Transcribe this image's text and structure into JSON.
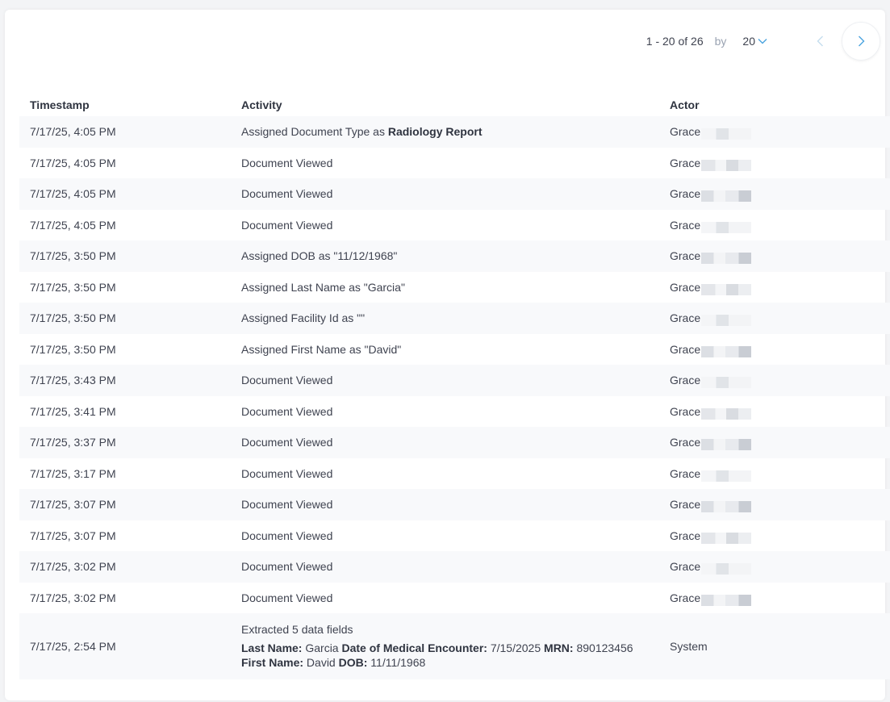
{
  "pagination": {
    "range": "1 - 20 of 26",
    "by_label": "by",
    "page_size": "20"
  },
  "table": {
    "headers": {
      "timestamp": "Timestamp",
      "activity": "Activity",
      "actor": "Actor"
    },
    "rows": [
      {
        "timestamp": "7/17/25, 4:05 PM",
        "activity_prefix": "Assigned Document Type as ",
        "activity_bold": "Radiology Report",
        "actor": "Grace"
      },
      {
        "timestamp": "7/17/25, 4:05 PM",
        "activity_prefix": "Document Viewed",
        "activity_bold": "",
        "actor": "Grace"
      },
      {
        "timestamp": "7/17/25, 4:05 PM",
        "activity_prefix": "Document Viewed",
        "activity_bold": "",
        "actor": "Grace"
      },
      {
        "timestamp": "7/17/25, 4:05 PM",
        "activity_prefix": "Document Viewed",
        "activity_bold": "",
        "actor": "Grace"
      },
      {
        "timestamp": "7/17/25, 3:50 PM",
        "activity_prefix": "Assigned DOB as \"11/12/1968\"",
        "activity_bold": "",
        "actor": "Grace"
      },
      {
        "timestamp": "7/17/25, 3:50 PM",
        "activity_prefix": "Assigned Last Name as \"Garcia\"",
        "activity_bold": "",
        "actor": "Grace"
      },
      {
        "timestamp": "7/17/25, 3:50 PM",
        "activity_prefix": "Assigned Facility Id as \"\"",
        "activity_bold": "",
        "actor": "Grace"
      },
      {
        "timestamp": "7/17/25, 3:50 PM",
        "activity_prefix": "Assigned First Name as \"David\"",
        "activity_bold": "",
        "actor": "Grace"
      },
      {
        "timestamp": "7/17/25, 3:43 PM",
        "activity_prefix": "Document Viewed",
        "activity_bold": "",
        "actor": "Grace"
      },
      {
        "timestamp": "7/17/25, 3:41 PM",
        "activity_prefix": "Document Viewed",
        "activity_bold": "",
        "actor": "Grace"
      },
      {
        "timestamp": "7/17/25, 3:37 PM",
        "activity_prefix": "Document Viewed",
        "activity_bold": "",
        "actor": "Grace"
      },
      {
        "timestamp": "7/17/25, 3:17 PM",
        "activity_prefix": "Document Viewed",
        "activity_bold": "",
        "actor": "Grace"
      },
      {
        "timestamp": "7/17/25, 3:07 PM",
        "activity_prefix": "Document Viewed",
        "activity_bold": "",
        "actor": "Grace"
      },
      {
        "timestamp": "7/17/25, 3:07 PM",
        "activity_prefix": "Document Viewed",
        "activity_bold": "",
        "actor": "Grace"
      },
      {
        "timestamp": "7/17/25, 3:02 PM",
        "activity_prefix": "Document Viewed",
        "activity_bold": "",
        "actor": "Grace"
      },
      {
        "timestamp": "7/17/25, 3:02 PM",
        "activity_prefix": "Document Viewed",
        "activity_bold": "",
        "actor": "Grace"
      }
    ],
    "extracted_row": {
      "timestamp": "7/17/25, 2:54 PM",
      "title": "Extracted 5 data fields",
      "fields": [
        {
          "label": "Last Name:",
          "value": "Garcia"
        },
        {
          "label": "Date of Medical Encounter:",
          "value": "7/15/2025"
        },
        {
          "label": "MRN:",
          "value": "890123456"
        },
        {
          "label": "First Name:",
          "value": "David"
        },
        {
          "label": "DOB:",
          "value": "11/11/1968"
        }
      ],
      "actor": "System"
    }
  },
  "colors": {
    "accent": "#4aa3df",
    "row_stripe": "#f8f9fb",
    "text": "#3f4350"
  },
  "icons": {
    "page_size": "chevron-down-icon",
    "prev": "chevron-left-icon",
    "next": "chevron-right-icon",
    "collapse": "chevron-up-icon"
  }
}
